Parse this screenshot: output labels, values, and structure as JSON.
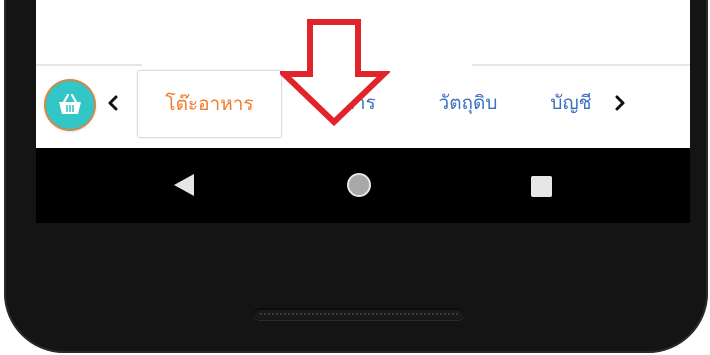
{
  "tabs": [
    {
      "label": "โต๊ะอาหาร",
      "active": true
    },
    {
      "label": "อาหาร",
      "active": false
    },
    {
      "label": "วัตถุดิบ",
      "active": false
    },
    {
      "label": "บัญชี",
      "active": false
    }
  ],
  "icons": {
    "basket": "basket-icon",
    "prev": "chevron-left-icon",
    "next": "chevron-right-icon",
    "annotation": "red-down-arrow-icon"
  },
  "colors": {
    "accent_teal": "#33c6c6",
    "active_tab": "#f07a2a",
    "inactive_tab": "#3a6fc4",
    "annotation_red": "#e1242b"
  }
}
